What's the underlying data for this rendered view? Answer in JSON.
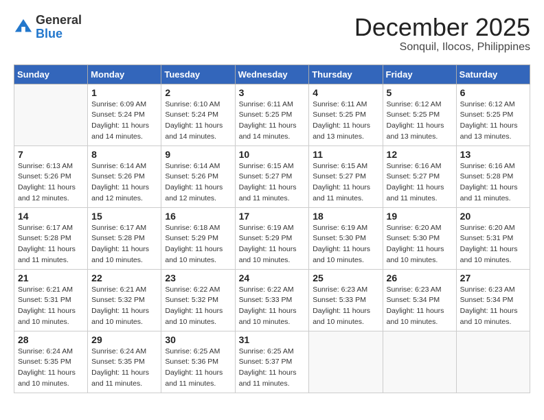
{
  "logo": {
    "general": "General",
    "blue": "Blue"
  },
  "title": "December 2025",
  "location": "Sonquil, Ilocos, Philippines",
  "weekdays": [
    "Sunday",
    "Monday",
    "Tuesday",
    "Wednesday",
    "Thursday",
    "Friday",
    "Saturday"
  ],
  "weeks": [
    [
      {
        "day": "",
        "sunrise": "",
        "sunset": "",
        "daylight": ""
      },
      {
        "day": "1",
        "sunrise": "Sunrise: 6:09 AM",
        "sunset": "Sunset: 5:24 PM",
        "daylight": "Daylight: 11 hours and 14 minutes."
      },
      {
        "day": "2",
        "sunrise": "Sunrise: 6:10 AM",
        "sunset": "Sunset: 5:24 PM",
        "daylight": "Daylight: 11 hours and 14 minutes."
      },
      {
        "day": "3",
        "sunrise": "Sunrise: 6:11 AM",
        "sunset": "Sunset: 5:25 PM",
        "daylight": "Daylight: 11 hours and 14 minutes."
      },
      {
        "day": "4",
        "sunrise": "Sunrise: 6:11 AM",
        "sunset": "Sunset: 5:25 PM",
        "daylight": "Daylight: 11 hours and 13 minutes."
      },
      {
        "day": "5",
        "sunrise": "Sunrise: 6:12 AM",
        "sunset": "Sunset: 5:25 PM",
        "daylight": "Daylight: 11 hours and 13 minutes."
      },
      {
        "day": "6",
        "sunrise": "Sunrise: 6:12 AM",
        "sunset": "Sunset: 5:25 PM",
        "daylight": "Daylight: 11 hours and 13 minutes."
      }
    ],
    [
      {
        "day": "7",
        "sunrise": "Sunrise: 6:13 AM",
        "sunset": "Sunset: 5:26 PM",
        "daylight": "Daylight: 11 hours and 12 minutes."
      },
      {
        "day": "8",
        "sunrise": "Sunrise: 6:14 AM",
        "sunset": "Sunset: 5:26 PM",
        "daylight": "Daylight: 11 hours and 12 minutes."
      },
      {
        "day": "9",
        "sunrise": "Sunrise: 6:14 AM",
        "sunset": "Sunset: 5:26 PM",
        "daylight": "Daylight: 11 hours and 12 minutes."
      },
      {
        "day": "10",
        "sunrise": "Sunrise: 6:15 AM",
        "sunset": "Sunset: 5:27 PM",
        "daylight": "Daylight: 11 hours and 11 minutes."
      },
      {
        "day": "11",
        "sunrise": "Sunrise: 6:15 AM",
        "sunset": "Sunset: 5:27 PM",
        "daylight": "Daylight: 11 hours and 11 minutes."
      },
      {
        "day": "12",
        "sunrise": "Sunrise: 6:16 AM",
        "sunset": "Sunset: 5:27 PM",
        "daylight": "Daylight: 11 hours and 11 minutes."
      },
      {
        "day": "13",
        "sunrise": "Sunrise: 6:16 AM",
        "sunset": "Sunset: 5:28 PM",
        "daylight": "Daylight: 11 hours and 11 minutes."
      }
    ],
    [
      {
        "day": "14",
        "sunrise": "Sunrise: 6:17 AM",
        "sunset": "Sunset: 5:28 PM",
        "daylight": "Daylight: 11 hours and 11 minutes."
      },
      {
        "day": "15",
        "sunrise": "Sunrise: 6:17 AM",
        "sunset": "Sunset: 5:28 PM",
        "daylight": "Daylight: 11 hours and 10 minutes."
      },
      {
        "day": "16",
        "sunrise": "Sunrise: 6:18 AM",
        "sunset": "Sunset: 5:29 PM",
        "daylight": "Daylight: 11 hours and 10 minutes."
      },
      {
        "day": "17",
        "sunrise": "Sunrise: 6:19 AM",
        "sunset": "Sunset: 5:29 PM",
        "daylight": "Daylight: 11 hours and 10 minutes."
      },
      {
        "day": "18",
        "sunrise": "Sunrise: 6:19 AM",
        "sunset": "Sunset: 5:30 PM",
        "daylight": "Daylight: 11 hours and 10 minutes."
      },
      {
        "day": "19",
        "sunrise": "Sunrise: 6:20 AM",
        "sunset": "Sunset: 5:30 PM",
        "daylight": "Daylight: 11 hours and 10 minutes."
      },
      {
        "day": "20",
        "sunrise": "Sunrise: 6:20 AM",
        "sunset": "Sunset: 5:31 PM",
        "daylight": "Daylight: 11 hours and 10 minutes."
      }
    ],
    [
      {
        "day": "21",
        "sunrise": "Sunrise: 6:21 AM",
        "sunset": "Sunset: 5:31 PM",
        "daylight": "Daylight: 11 hours and 10 minutes."
      },
      {
        "day": "22",
        "sunrise": "Sunrise: 6:21 AM",
        "sunset": "Sunset: 5:32 PM",
        "daylight": "Daylight: 11 hours and 10 minutes."
      },
      {
        "day": "23",
        "sunrise": "Sunrise: 6:22 AM",
        "sunset": "Sunset: 5:32 PM",
        "daylight": "Daylight: 11 hours and 10 minutes."
      },
      {
        "day": "24",
        "sunrise": "Sunrise: 6:22 AM",
        "sunset": "Sunset: 5:33 PM",
        "daylight": "Daylight: 11 hours and 10 minutes."
      },
      {
        "day": "25",
        "sunrise": "Sunrise: 6:23 AM",
        "sunset": "Sunset: 5:33 PM",
        "daylight": "Daylight: 11 hours and 10 minutes."
      },
      {
        "day": "26",
        "sunrise": "Sunrise: 6:23 AM",
        "sunset": "Sunset: 5:34 PM",
        "daylight": "Daylight: 11 hours and 10 minutes."
      },
      {
        "day": "27",
        "sunrise": "Sunrise: 6:23 AM",
        "sunset": "Sunset: 5:34 PM",
        "daylight": "Daylight: 11 hours and 10 minutes."
      }
    ],
    [
      {
        "day": "28",
        "sunrise": "Sunrise: 6:24 AM",
        "sunset": "Sunset: 5:35 PM",
        "daylight": "Daylight: 11 hours and 10 minutes."
      },
      {
        "day": "29",
        "sunrise": "Sunrise: 6:24 AM",
        "sunset": "Sunset: 5:35 PM",
        "daylight": "Daylight: 11 hours and 11 minutes."
      },
      {
        "day": "30",
        "sunrise": "Sunrise: 6:25 AM",
        "sunset": "Sunset: 5:36 PM",
        "daylight": "Daylight: 11 hours and 11 minutes."
      },
      {
        "day": "31",
        "sunrise": "Sunrise: 6:25 AM",
        "sunset": "Sunset: 5:37 PM",
        "daylight": "Daylight: 11 hours and 11 minutes."
      },
      {
        "day": "",
        "sunrise": "",
        "sunset": "",
        "daylight": ""
      },
      {
        "day": "",
        "sunrise": "",
        "sunset": "",
        "daylight": ""
      },
      {
        "day": "",
        "sunrise": "",
        "sunset": "",
        "daylight": ""
      }
    ]
  ]
}
